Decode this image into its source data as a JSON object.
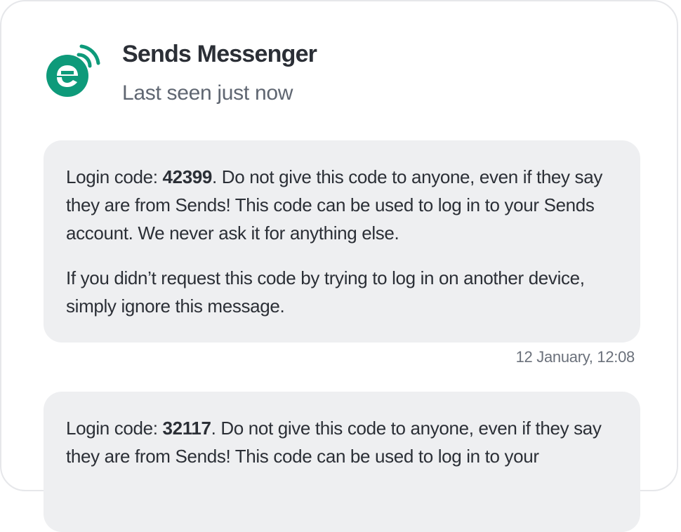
{
  "contact": {
    "name": "Sends Messenger",
    "status": "Last seen just now",
    "logo_icon": "sends-logo-icon",
    "brand_color": "#0e9a7a"
  },
  "messages": [
    {
      "prefix": "Login code: ",
      "code": "42399",
      "body": ". Do not give this code to anyone, even if they say they are from Sends! This code can be used to log in to your Sends account. We never ask it for anything else.",
      "note": "If you didn’t request this code by trying to log in on another device, simply ignore this message.",
      "timestamp": "12 January, 12:08"
    },
    {
      "prefix": "Login code: ",
      "code": "32117",
      "body": ". Do not give this code to anyone, even if they say they are from Sends! This code can be used to log in to your"
    }
  ]
}
